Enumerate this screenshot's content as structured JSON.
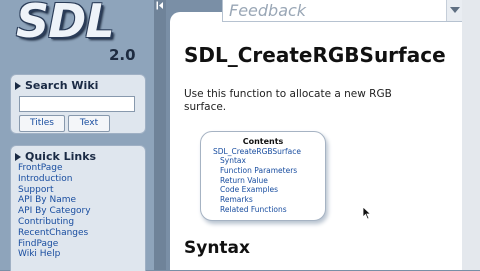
{
  "logo": {
    "text": "SDL",
    "version": "2.0"
  },
  "search": {
    "title": "Search Wiki",
    "input_value": "",
    "titles_button": "Titles",
    "text_button": "Text"
  },
  "quick_links": {
    "title": "Quick Links",
    "items": [
      "FrontPage",
      "Introduction",
      "Support",
      "API By Name",
      "API By Category",
      "Contributing",
      "RecentChanges",
      "FindPage",
      "Wiki Help"
    ]
  },
  "feedback": {
    "label": "Feedback"
  },
  "page": {
    "title": "SDL_CreateRGBSurface",
    "description": "Use this function to allocate a new RGB surface.",
    "toc": {
      "title": "Contents",
      "root": "SDL_CreateRGBSurface",
      "items": [
        "Syntax",
        "Function Parameters",
        "Return Value",
        "Code Examples",
        "Remarks",
        "Related Functions"
      ]
    },
    "section_heading": "Syntax"
  },
  "colors": {
    "link": "#1a4ea0",
    "sidebar_bg": "#8ea4bb",
    "panel_bg": "#dfe6ee"
  }
}
